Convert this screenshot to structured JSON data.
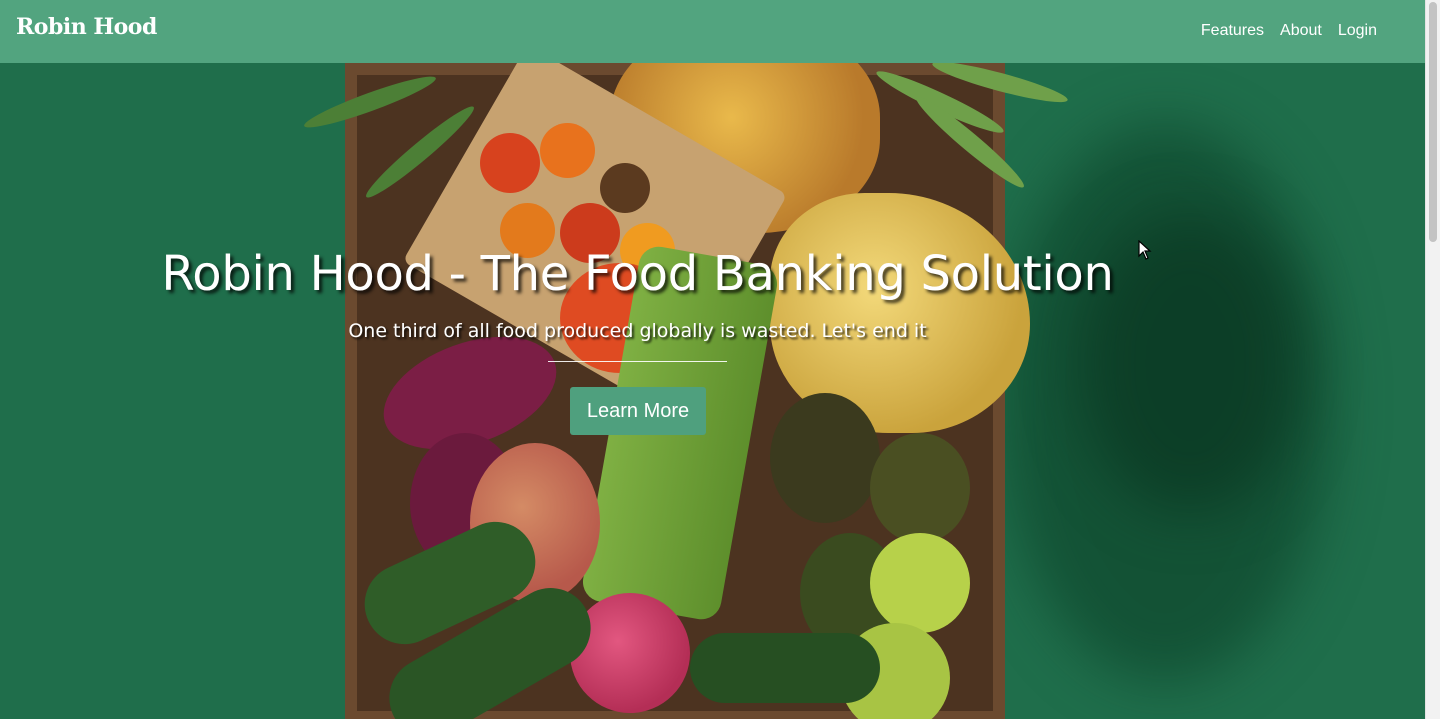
{
  "navbar": {
    "brand": "Robin Hood",
    "links": [
      "Features",
      "About",
      "Login"
    ],
    "background": "#52a47f"
  },
  "hero": {
    "title": "Robin Hood - The Food Banking Solution",
    "subtitle": "One third of all food produced globally is wasted. Let's end it",
    "cta_label": "Learn More",
    "background_image": "crate-of-fruits-and-vegetables",
    "background_color": "#1f6e4b",
    "cta_color": "#4fa07e"
  },
  "cursor": {
    "icon": "arrow-pointer-icon"
  }
}
